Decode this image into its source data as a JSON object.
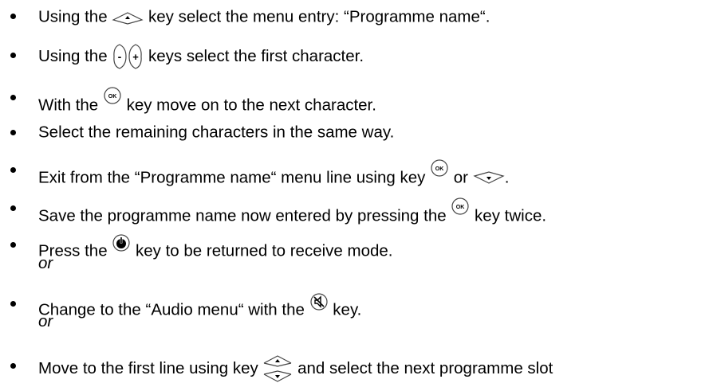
{
  "instructions": [
    {
      "parts": [
        "Using the ",
        " key select the menu entry: “Programme name“."
      ]
    },
    {
      "parts": [
        "Using the ",
        " keys select the first character."
      ]
    },
    {
      "parts": [
        "With the ",
        " key move on to the next character."
      ]
    },
    {
      "parts": [
        "Select the remaining characters in the same way."
      ]
    },
    {
      "parts": [
        "Exit from the “Programme name“ menu line using key ",
        " or ",
        "."
      ]
    },
    {
      "parts": [
        "Save the programme name now entered by pressing the ",
        " key twice."
      ]
    },
    {
      "parts": [
        "Press the ",
        " key to be returned to receive mode."
      ],
      "after": "or"
    },
    {
      "parts": [
        "Change to the “Audio menu“ with the ",
        " key."
      ],
      "after": "or"
    },
    {
      "parts": [
        "Move to the first line using key ",
        " and select the next programme slot"
      ]
    }
  ],
  "icons": {
    "up": "up-arrow-key-icon",
    "minus_plus": "minus-plus-keys-icon",
    "ok": "ok-key-icon",
    "down": "down-arrow-key-icon",
    "power": "power-key-icon",
    "mute": "mute-key-icon",
    "updown": "up-down-arrow-key-icon"
  },
  "labels": {
    "ok": "OK",
    "minus": "-",
    "plus": "+"
  }
}
